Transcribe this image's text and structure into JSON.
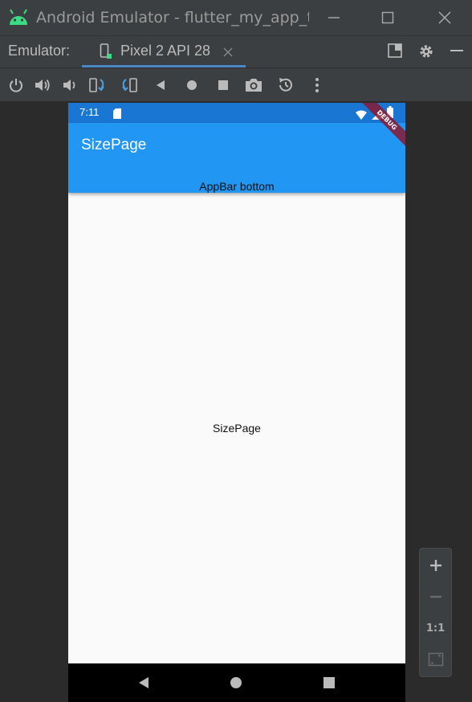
{
  "window": {
    "title": "Android Emulator - flutter_my_app_te"
  },
  "tabbar": {
    "label": "Emulator:",
    "tab_label": "Pixel 2 API 28"
  },
  "toolbar": {
    "icons": [
      "power-icon",
      "volume-up-icon",
      "volume-down-icon",
      "rotate-left-icon",
      "rotate-right-icon",
      "back-icon",
      "home-icon",
      "overview-icon",
      "camera-icon",
      "snapshot-icon",
      "more-icon"
    ]
  },
  "device": {
    "status_time": "7:11",
    "appbar_title": "SizePage",
    "appbar_bottom": "AppBar bottom",
    "body_text": "SizePage",
    "debug_banner": "DEBUG"
  },
  "zoom": {
    "ratio_label": "1:1"
  },
  "colors": {
    "appbar": "#2196f3",
    "statusbar": "#1976d2",
    "ide_background": "#3c3f41",
    "tab_underline": "#4a88c7"
  }
}
